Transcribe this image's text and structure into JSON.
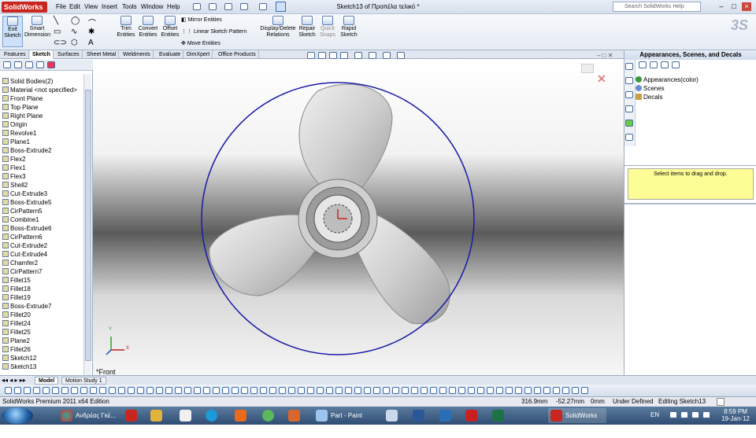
{
  "app": {
    "logo": "SolidWorks",
    "title": "Sketch13 of Προπέλα τελικό *",
    "help_placeholder": "Search SolidWorks Help"
  },
  "menu": [
    "File",
    "Edit",
    "View",
    "Insert",
    "Tools",
    "Window",
    "Help"
  ],
  "ribbon": {
    "exit_sketch": "Exit Sketch",
    "smart_dimension": "Smart Dimension",
    "trim_entities": "Trim Entities",
    "convert_entities": "Convert Entities",
    "offset_entities": "Offset Entities",
    "mirror_entities": "Mirror Entities",
    "linear_sketch_pattern": "Linear Sketch Pattern",
    "move_entities": "Move Entities",
    "display_delete_relations": "Display/Delete Relations",
    "repair_sketch": "Repair Sketch",
    "quick_snaps": "Quick Snaps",
    "rapid_sketch": "Rapid Sketch"
  },
  "tabs": [
    "Features",
    "Sketch",
    "Surfaces",
    "Sheet Metal",
    "Weldments",
    "Evaluate",
    "DimXpert",
    "Office Products"
  ],
  "tree": [
    "Solid Bodies(2)",
    "Material <not specified>",
    "Front Plane",
    "Top Plane",
    "Right Plane",
    "Origin",
    "Revolve1",
    "Plane1",
    "Boss-Extrude2",
    "Flex2",
    "Flex1",
    "Flex3",
    "Shell2",
    "Cut-Extrude3",
    "Boss-Extrude5",
    "CirPattern5",
    "Combine1",
    "Boss-Extrude6",
    "CirPattern6",
    "Cut-Extrude2",
    "Cut-Extrude4",
    "Chamfer2",
    "CirPattern7",
    "Fillet15",
    "Fillet18",
    "Fillet19",
    "Boss-Extrude7",
    "Fillet20",
    "Fillet24",
    "Fillet25",
    "Plane2",
    "Fillet26",
    "Sketch12",
    "Sketch13"
  ],
  "viewport": {
    "view_label": "*Front",
    "triad_y": "Y",
    "triad_x": "X"
  },
  "right_panel": {
    "title": "Appearances, Scenes, and Decals",
    "items": [
      "Appearances(color)",
      "Scenes",
      "Decals"
    ],
    "drop_hint": "Select items to drag and drop."
  },
  "bottom_tabs": [
    "Model",
    "Motion Study 1"
  ],
  "status": {
    "edition": "SolidWorks Premium 2011 x64 Edition",
    "x": "316.9mm",
    "y": "-52.27mm",
    "z": "0mm",
    "state": "Under Defined",
    "editing": "Editing Sketch13"
  },
  "taskbar": {
    "chrome": "Ανδρέας Γκέ...",
    "paint": "Part - Paint",
    "solidworks": "SolidWorks P...",
    "lang": "EN",
    "time": "8:59 PM",
    "date": "19-Jan-12"
  },
  "colors": {
    "accent": "#c8261e",
    "sketch_circle": "#1a1aa6",
    "hint_bg": "#fdfd96"
  }
}
